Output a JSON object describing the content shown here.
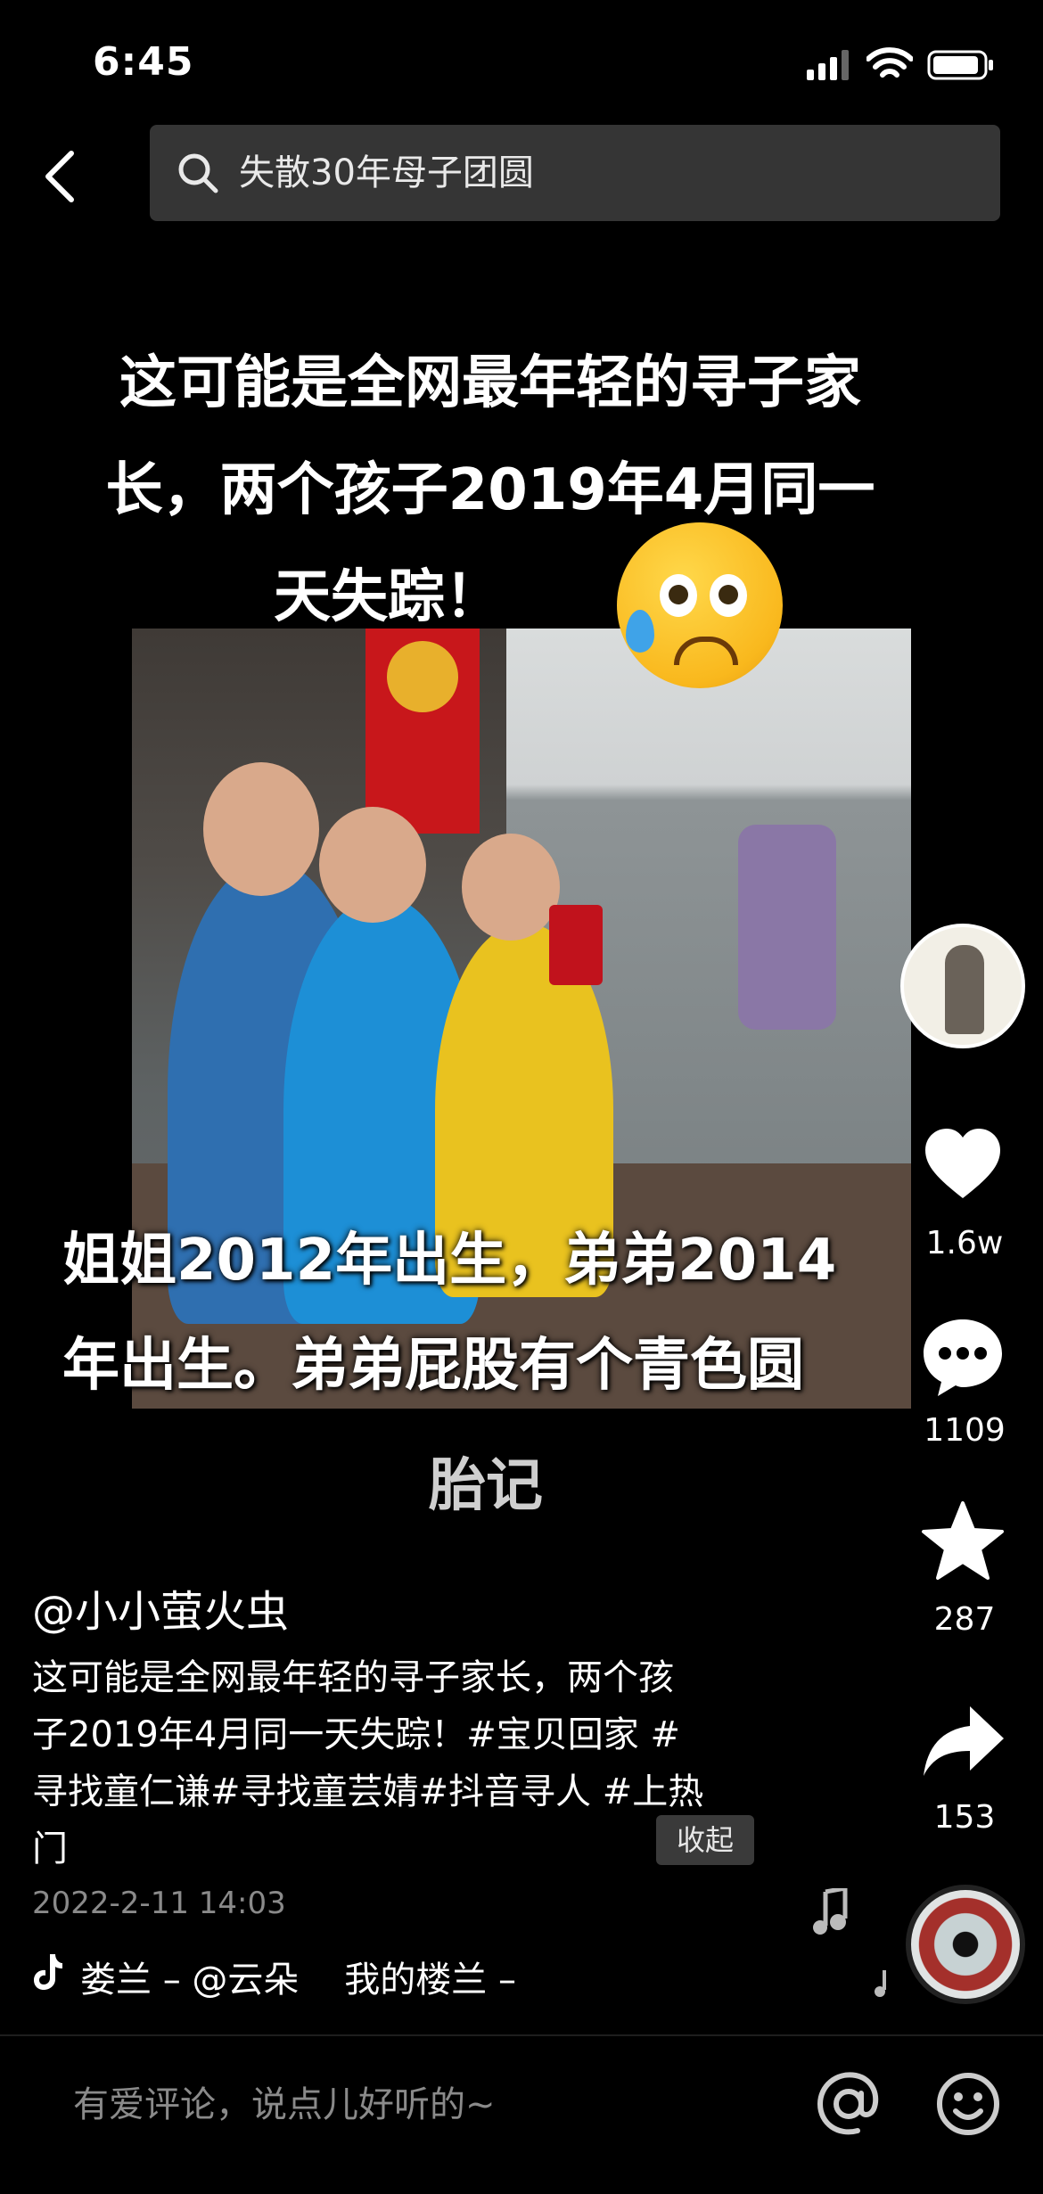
{
  "status_bar": {
    "time": "6:45"
  },
  "search": {
    "query": "失散30年母子团圆"
  },
  "video": {
    "caption_top": "这可能是全网最年轻的寻子家长，两个孩子2019年4月同一天失踪！",
    "caption_top_lines": [
      "这可能是全网最年轻的寻子家",
      "长，两个孩子2019年4月同一",
      "天失踪！"
    ],
    "caption_mid_lines": [
      "姐姐2012年出生，弟弟2014",
      "年出生。弟弟屁股有个青色圆"
    ],
    "caption_mid_last": "胎记"
  },
  "rail": {
    "likes": "1.6w",
    "comments": "1109",
    "favorites": "287",
    "shares": "153"
  },
  "post": {
    "author": "@小小萤火虫",
    "desc_lines": [
      "这可能是全网最年轻的寻子家长，两个孩",
      "子2019年4月同一天失踪！#宝贝回家 #",
      "寻找童仁谦#寻找童芸婧#抖音寻人 #上热",
      "门"
    ],
    "collapse_label": "收起",
    "date": "2022-2-11 14:03",
    "music": "娄兰 – @云朵    我的楼兰 –"
  },
  "comment_bar": {
    "placeholder": "有爱评论，说点儿好听的~"
  },
  "colors": {
    "background": "#000000",
    "search_bg": "#353535",
    "muted_text": "#8a8a8a"
  },
  "icons": [
    "back-icon",
    "search-icon",
    "signal-icon",
    "wifi-icon",
    "battery-icon",
    "heart-icon",
    "comment-icon",
    "star-icon",
    "share-icon",
    "tiktok-icon",
    "music-note-icon",
    "at-icon",
    "smile-icon"
  ]
}
